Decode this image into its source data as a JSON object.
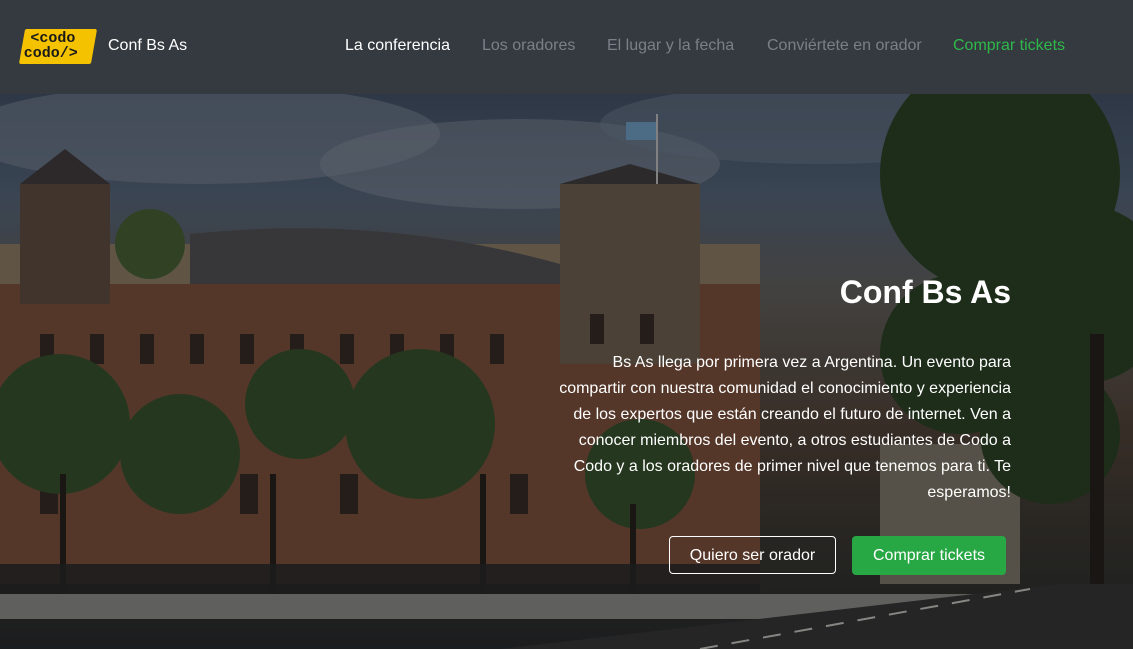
{
  "header": {
    "logo_line1": "<codo",
    "logo_line2": "codo/>",
    "brand": "Conf Bs As",
    "nav": [
      {
        "label": "La conferencia"
      },
      {
        "label": "Los oradores"
      },
      {
        "label": "El lugar y la fecha"
      },
      {
        "label": "Conviértete en orador"
      },
      {
        "label": "Comprar tickets"
      }
    ]
  },
  "hero": {
    "title": "Conf Bs As",
    "description": "Bs As llega por primera vez a Argentina. Un evento para compartir con nuestra comunidad el conocimiento y experiencia de los expertos que están creando el futuro de internet. Ven a conocer miembros del evento, a otros estudiantes de Codo a Codo y a los oradores de primer nivel que tenemos para ti. Te esperamos!",
    "btn_speaker": "Quiero ser orador",
    "btn_tickets": "Comprar tickets"
  },
  "colors": {
    "navbar_bg": "#343a40",
    "active": "#ffffff",
    "inactive": "#7b8087",
    "cta_green": "#28a745",
    "logo_yellow": "#f5c200"
  }
}
